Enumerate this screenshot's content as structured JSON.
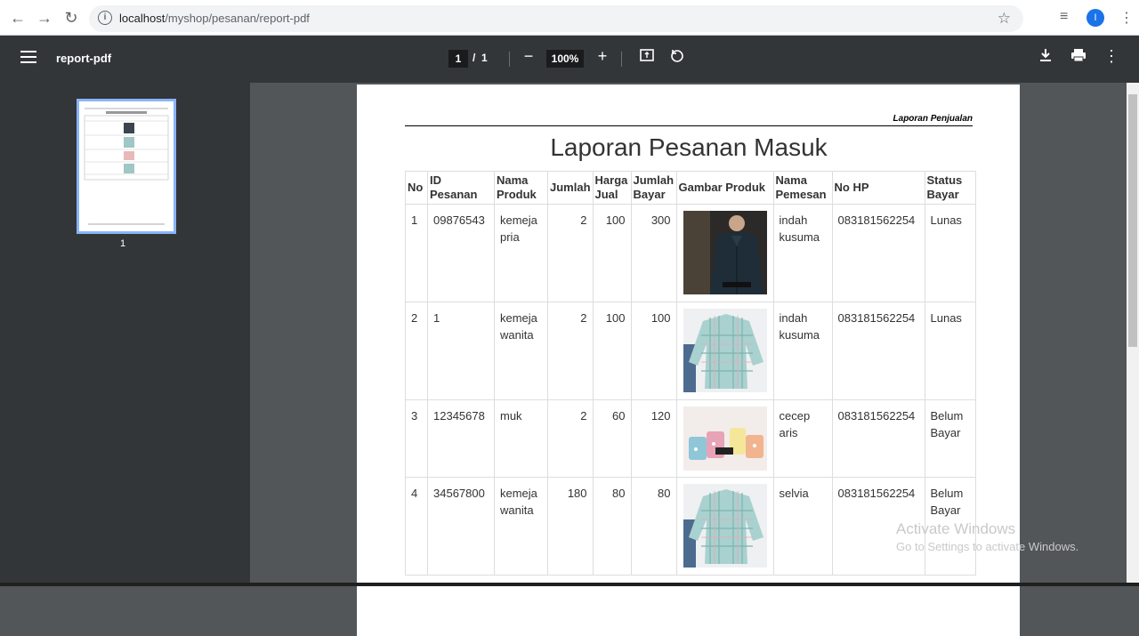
{
  "browser": {
    "url_host": "localhost",
    "url_path": "/myshop/pesanan/report-pdf",
    "profile_initial": "I"
  },
  "toolbar": {
    "title": "report-pdf",
    "current_page": "1",
    "page_separator": "/",
    "total_pages": "1",
    "zoom": "100%"
  },
  "sidebar": {
    "thumb_page_number": "1"
  },
  "report": {
    "header_right": "Laporan Penjualan",
    "title": "Laporan Pesanan Masuk",
    "columns": [
      "No",
      "ID Pesanan",
      "Nama Produk",
      "Jumlah",
      "Harga Jual",
      "Jumlah Bayar",
      "Gambar Produk",
      "Nama Pemesan",
      "No HP",
      "Status Bayar"
    ],
    "rows": [
      {
        "no": "1",
        "id": "09876543",
        "produk": "kemeja pria",
        "jumlah": "2",
        "harga": "100",
        "bayar": "300",
        "gambar": "dark-shirt-photo",
        "pemesan": "indah kusuma",
        "hp": "083181562254",
        "status": "Lunas"
      },
      {
        "no": "2",
        "id": "1",
        "produk": "kemeja wanita",
        "jumlah": "2",
        "harga": "100",
        "bayar": "100",
        "gambar": "plaid-shirt-photo",
        "pemesan": "indah kusuma",
        "hp": "083181562254",
        "status": "Lunas"
      },
      {
        "no": "3",
        "id": "12345678",
        "produk": "muk",
        "jumlah": "2",
        "harga": "60",
        "bayar": "120",
        "gambar": "mugs-photo",
        "pemesan": "cecep aris",
        "hp": "083181562254",
        "status": "Belum Bayar"
      },
      {
        "no": "4",
        "id": "34567800",
        "produk": "kemeja wanita",
        "jumlah": "180",
        "harga": "80",
        "bayar": "80",
        "gambar": "plaid-shirt-photo",
        "pemesan": "selvia",
        "hp": "083181562254",
        "status": "Belum Bayar"
      }
    ]
  },
  "watermark": {
    "line1": "Activate Windows",
    "line2": "Go to Settings to activate Windows."
  }
}
